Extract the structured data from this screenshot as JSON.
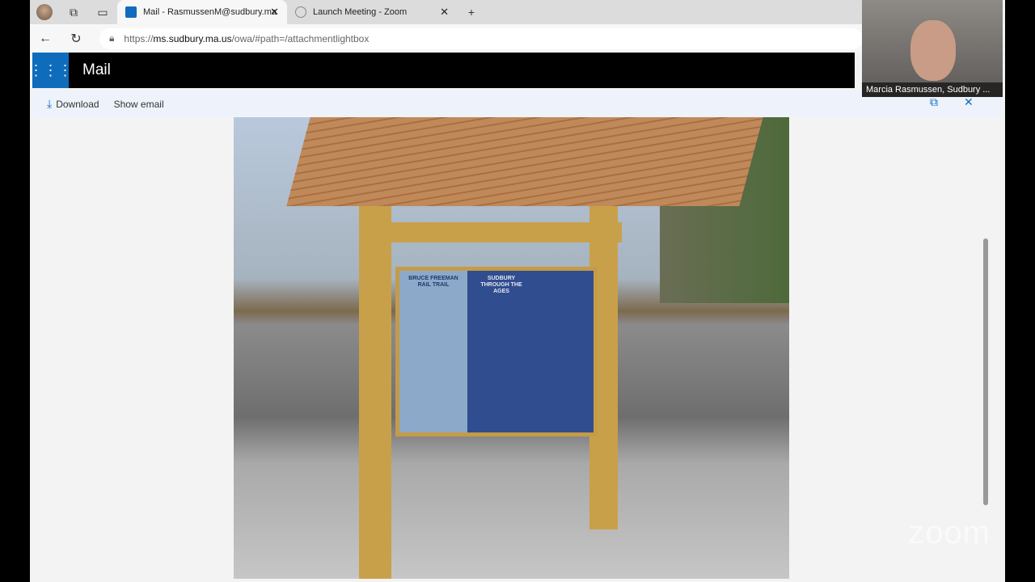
{
  "browser": {
    "tabs": [
      {
        "label": "Mail - RasmussenM@sudbury.ma",
        "active": true
      },
      {
        "label": "Launch Meeting - Zoom",
        "active": false
      }
    ],
    "url_prefix": "https://",
    "url_domain": "ms.sudbury.ma.us",
    "url_path": "/owa/#path=/attachmentlightbox"
  },
  "app": {
    "title": "Mail"
  },
  "toolbar": {
    "download": "Download",
    "show_email": "Show email"
  },
  "photo": {
    "sign_title": "BRUCE FREEMAN RAIL TRAIL",
    "sign_subtitle": "SUDBURY THROUGH THE AGES"
  },
  "zoom": {
    "participant": "Marcia Rasmussen, Sudbury ...",
    "watermark": "zoom"
  },
  "colors": {
    "accent": "#0f6cbd"
  }
}
